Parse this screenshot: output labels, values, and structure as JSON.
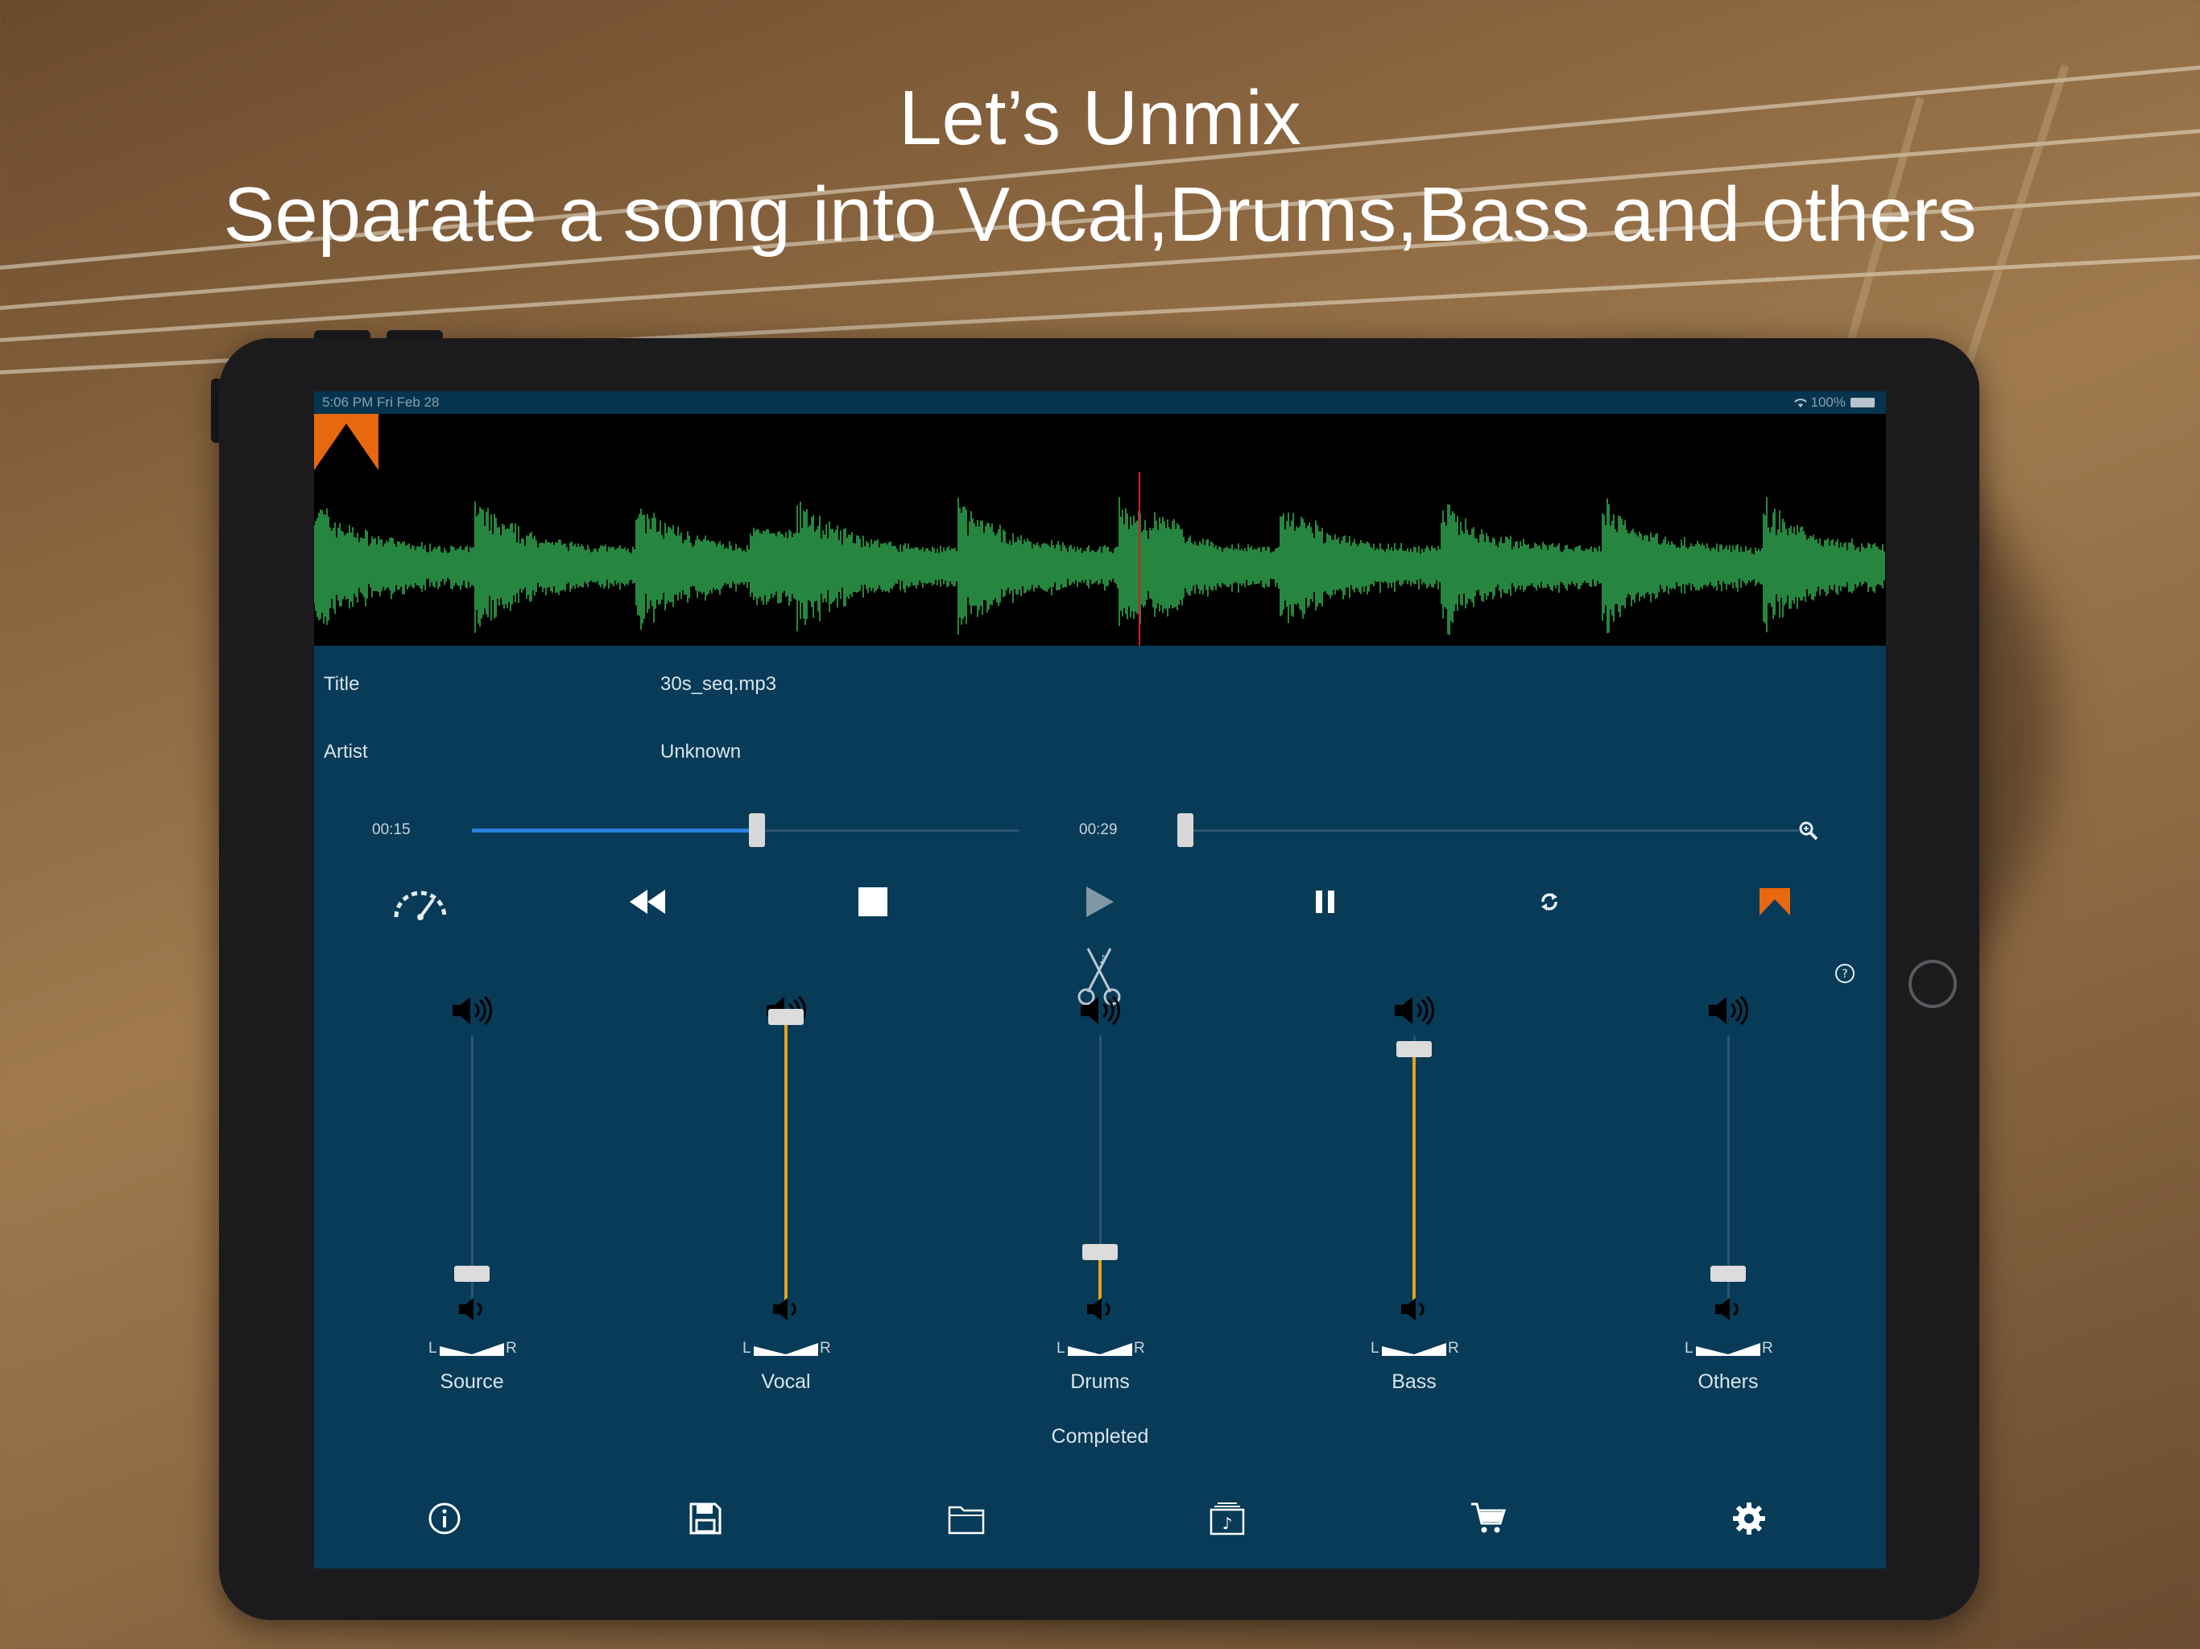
{
  "promo": {
    "line1": "Let’s Unmix",
    "line2": "Separate a song into Vocal,Drums,Bass and others"
  },
  "status_bar": {
    "time": "5:06 PM  Fri Feb 28",
    "battery": "100%"
  },
  "track_info": {
    "title_label": "Title",
    "title_value": "30s_seq.mp3",
    "artist_label": "Artist",
    "artist_value": "Unknown"
  },
  "playback": {
    "position_time": "00:15",
    "position_fraction": 0.52,
    "duration_time": "00:29",
    "second_slider_fraction": 0.0
  },
  "controls": [
    "speed-icon",
    "rewind-icon",
    "stop-icon",
    "play-icon",
    "pause-icon",
    "loop-icon",
    "marker-icon"
  ],
  "mixer": {
    "pan_left": "L",
    "pan_right": "R",
    "channels": [
      {
        "name": "Source",
        "level": 0.0
      },
      {
        "name": "Vocal",
        "level": 0.95
      },
      {
        "name": "Drums",
        "level": 0.08
      },
      {
        "name": "Bass",
        "level": 0.83
      },
      {
        "name": "Others",
        "level": 0.0
      }
    ]
  },
  "status": "Completed",
  "tabbar": [
    "info-icon",
    "save-icon",
    "folder-icon",
    "music-library-icon",
    "cart-icon",
    "settings-icon"
  ],
  "colors": {
    "screen_bg": "#073b58",
    "waveform": "#2fa84f",
    "accent_orange": "#e8680f",
    "fader_fill": "#e4a21a",
    "progress_fill": "#2a7fe0"
  }
}
